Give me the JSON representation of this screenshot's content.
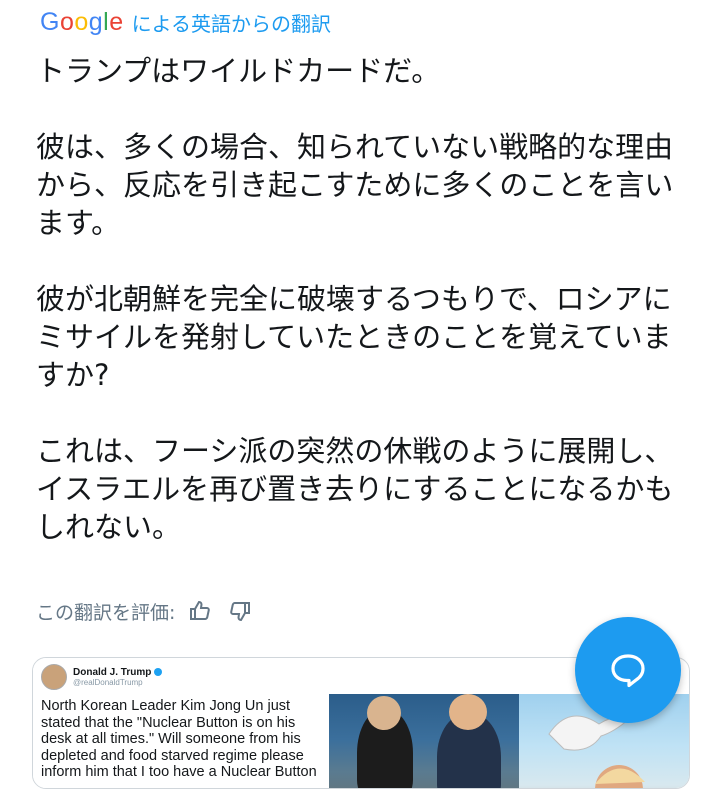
{
  "header": {
    "logo_text": "Google",
    "translated_by": "による英語からの翻訳"
  },
  "tweet": {
    "paragraphs": [
      "トランプはワイルドカードだ。",
      "彼は、多くの場合、知られていない戦略的な理由から、反応を引き起こすために多くのことを言います。",
      "彼が北朝鮮を完全に破壊するつもりで、ロシアにミサイルを発射していたときのことを覚えていますか?",
      "これは、フーシ派の突然の休戦のように展開し、イスラエルを再び置き去りにすることになるかもしれない。"
    ]
  },
  "rating": {
    "label": "この翻訳を評価:",
    "thumbs_up_icon": "thumbs-up-icon",
    "thumbs_down_icon": "thumbs-down-icon"
  },
  "media": {
    "embedded_tweet": {
      "name": "Donald J. Trump",
      "handle": "@realDonaldTrump",
      "text": "North Korean Leader Kim Jong Un just stated that the \"Nuclear Button is on his desk at all times.\" Will someone from his depleted and food starved regime please inform him that I too have a Nuclear Button"
    }
  },
  "fab": {
    "icon": "chat-bubble-icon",
    "color": "#1d9bf0"
  }
}
